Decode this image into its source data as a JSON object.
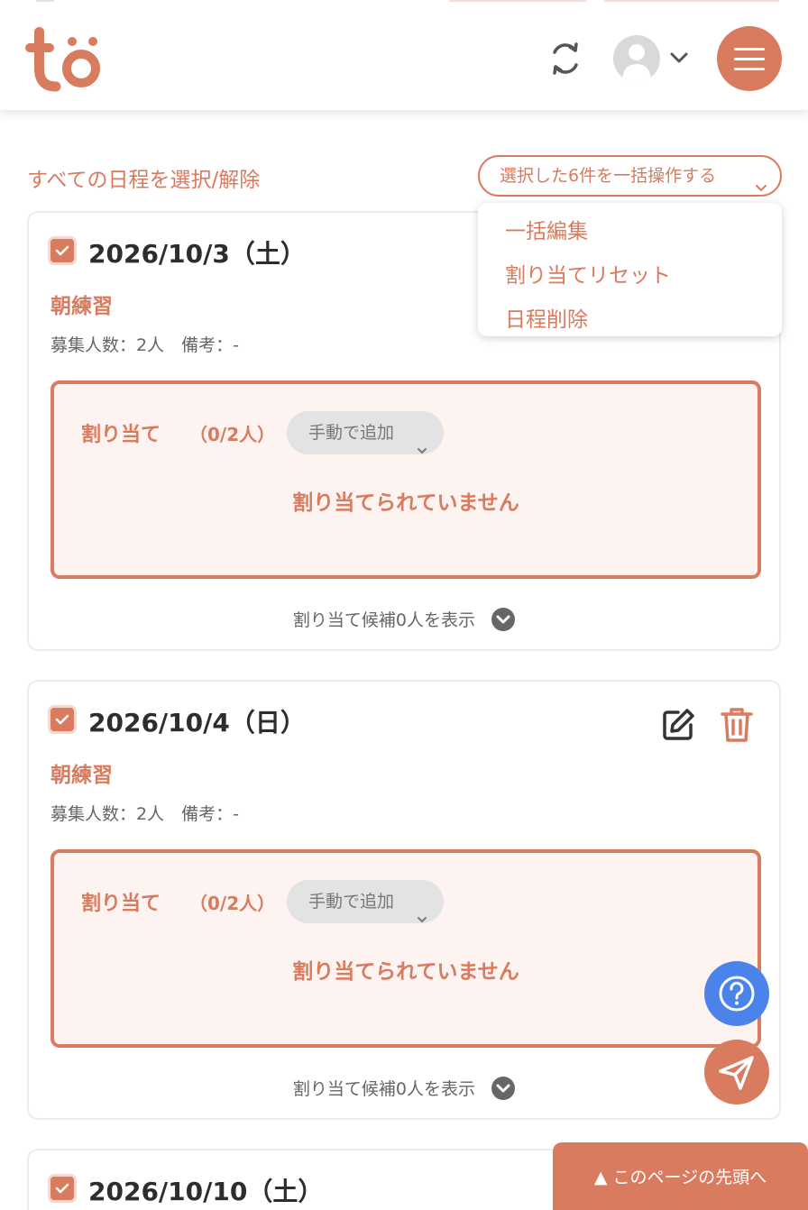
{
  "header": {
    "logo_text": "tö",
    "icons": {
      "refresh": "refresh-icon",
      "avatar": "user-avatar-icon",
      "chevron": "chevron-down-icon",
      "menu": "hamburger-menu-icon"
    }
  },
  "toolbar": {
    "select_all_label": "すべての日程を選択/解除",
    "bulk_action_label": "選択した6件を一括操作する"
  },
  "bulk_menu": {
    "items": [
      {
        "label": "一括編集"
      },
      {
        "label": "割り当てリセット"
      },
      {
        "label": "日程削除"
      }
    ]
  },
  "schedules": [
    {
      "date": "2026/10/3（土）",
      "checked": true,
      "title": "朝練習",
      "meta": "募集人数：2人　備考：-",
      "assign_label": "割り当て",
      "assign_count": "（0/2人）",
      "manual_add_label": "手動で追加",
      "empty_message": "割り当てられていません",
      "candidates_label": "割り当て候補0人を表示"
    },
    {
      "date": "2026/10/4（日）",
      "checked": true,
      "title": "朝練習",
      "meta": "募集人数：2人　備考：-",
      "assign_label": "割り当て",
      "assign_count": "（0/2人）",
      "manual_add_label": "手動で追加",
      "empty_message": "割り当てられていません",
      "candidates_label": "割り当て候補0人を表示"
    },
    {
      "date": "2026/10/10（土）",
      "checked": true
    }
  ],
  "floating": {
    "help_icon": "question-mark-icon",
    "send_icon": "paper-plane-icon",
    "page_top_label": "▲ このページの先頭へ"
  },
  "colors": {
    "accent": "#d97b5f",
    "accent_light": "#fdf3f0",
    "help_blue": "#4a84ea",
    "muted": "#e3e3e3"
  }
}
